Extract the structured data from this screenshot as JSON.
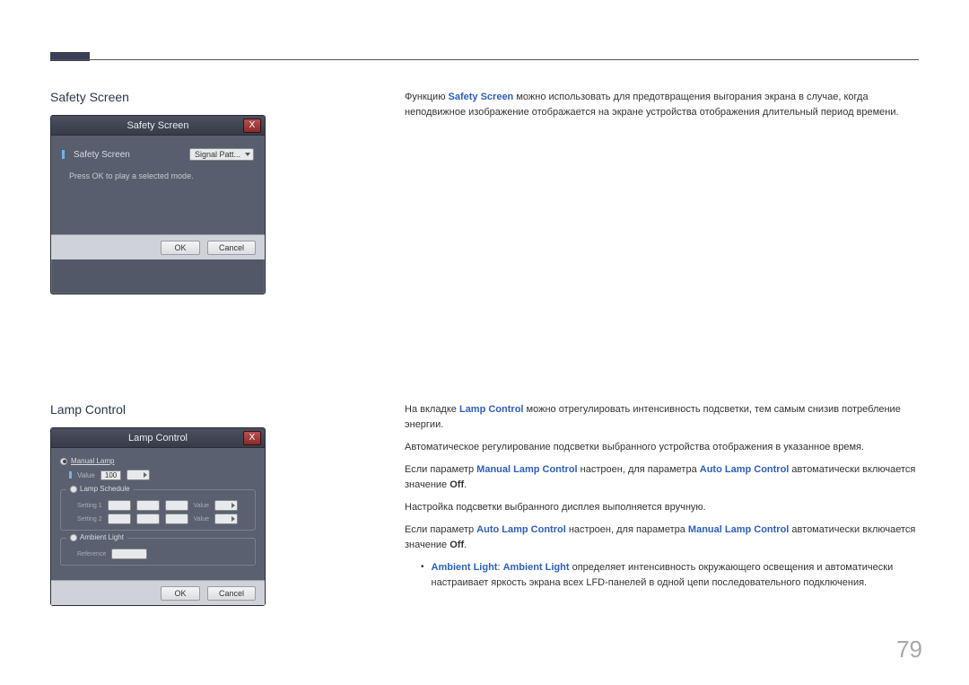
{
  "page_number": "79",
  "section1": {
    "title": "Safety Screen",
    "dialog": {
      "title": "Safety Screen",
      "field_label": "Safety Screen",
      "combo_value": "Signal Patt...",
      "hint": "Press OK to play a selected mode.",
      "ok": "OK",
      "cancel": "Cancel",
      "close": "X"
    },
    "description": {
      "p1a": "Функцию ",
      "p1b": "Safety Screen",
      "p1c": " можно использовать для предотвращения выгорания экрана в случае, когда неподвижное изображение отображается на экране устройства отображения длительный период времени."
    }
  },
  "section2": {
    "title": "Lamp Control",
    "dialog": {
      "title": "Lamp Control",
      "manual_lamp": "Manual Lamp",
      "value_label": "Value",
      "value_num": "100",
      "lamp_schedule": "Lamp Schedule",
      "setting1": "Setting 1",
      "setting2": "Setting 2",
      "value_row": "Value",
      "ambient": "Ambient Light",
      "reference": "Reference",
      "ok": "OK",
      "cancel": "Cancel",
      "close": "X"
    },
    "description": {
      "p1a": "На вкладке ",
      "p1b": "Lamp Control",
      "p1c": " можно отрегулировать интенсивность подсветки, тем самым снизив потребление энергии.",
      "p2": "Автоматическое регулирование подсветки выбранного устройства отображения в указанное время.",
      "p3a": "Если параметр ",
      "p3b": "Manual Lamp Control",
      "p3c": " настроен, для параметра ",
      "p3d": "Auto Lamp Control",
      "p3e": " автоматически включается значение ",
      "p3f": "Off",
      "p3g": ".",
      "p4": "Настройка подсветки выбранного дисплея выполняется вручную.",
      "p5a": "Если параметр ",
      "p5b": "Auto Lamp Control",
      "p5c": " настроен, для параметра ",
      "p5d": "Manual Lamp Control",
      "p5e": " автоматически включается значение ",
      "p5f": "Off",
      "p5g": ".",
      "b1a": "Ambient Light",
      "b1b": ": ",
      "b1c": "Ambient Light",
      "b1d": " определяет интенсивность окружающего освещения и автоматически настраивает яркость экрана всех LFD-панелей в одной цепи последовательного подключения."
    }
  }
}
